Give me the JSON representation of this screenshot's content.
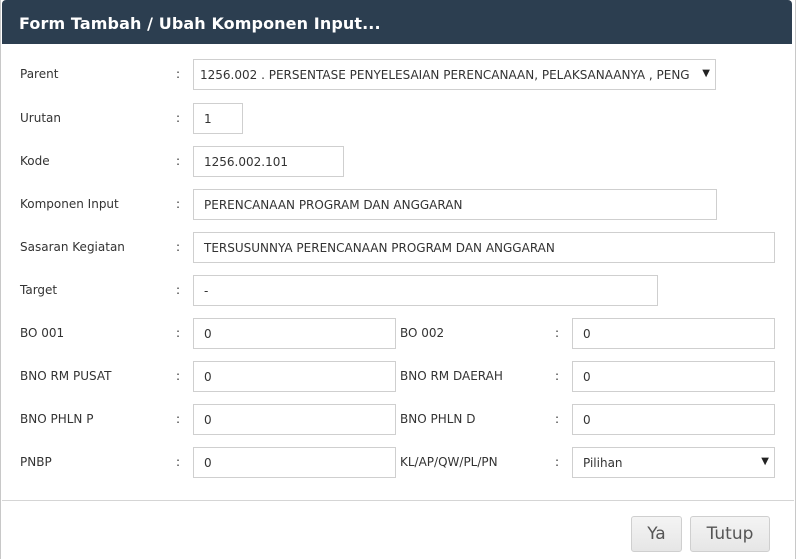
{
  "dialog": {
    "title": "Form Tambah / Ubah Komponen Input..."
  },
  "form": {
    "colon": ":",
    "parent": {
      "label": "Parent",
      "value": "1256.002 . PERSENTASE PENYELESAIAN PERENCANAAN, PELAKSANAANYA , PENG",
      "caret": "▼"
    },
    "urutan": {
      "label": "Urutan",
      "value": "1"
    },
    "kode": {
      "label": "Kode",
      "value": "1256.002.101"
    },
    "komponen_input": {
      "label": "Komponen Input",
      "value": "PERENCANAAN PROGRAM DAN ANGGARAN"
    },
    "sasaran_kegiatan": {
      "label": "Sasaran Kegiatan",
      "value": "TERSUSUNNYA PERENCANAAN PROGRAM DAN ANGGARAN"
    },
    "target": {
      "label": "Target",
      "value": "-"
    },
    "bo_001": {
      "label": "BO 001",
      "value": "0"
    },
    "bo_002": {
      "label": "BO 002",
      "value": "0"
    },
    "bno_rm_pusat": {
      "label": "BNO RM PUSAT",
      "value": "0"
    },
    "bno_rm_daerah": {
      "label": "BNO RM DAERAH",
      "value": "0"
    },
    "bno_phln_p": {
      "label": "BNO PHLN P",
      "value": "0"
    },
    "bno_phln_d": {
      "label": "BNO PHLN D",
      "value": "0"
    },
    "pnbp": {
      "label": "PNBP",
      "value": "0"
    },
    "kl_ap": {
      "label": "KL/AP/QW/PL/PN",
      "value": "Pilihan",
      "caret": "▼"
    }
  },
  "footer": {
    "ya_label": "Ya",
    "tutup_label": "Tutup"
  }
}
